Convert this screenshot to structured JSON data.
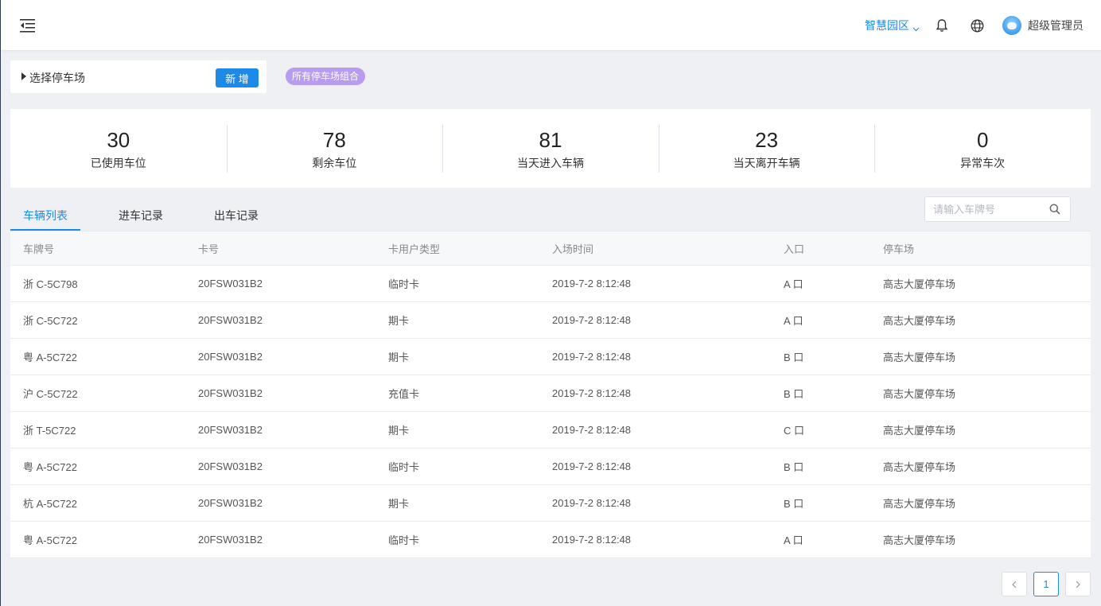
{
  "header": {
    "park_name": "智慧园区",
    "user_name": "超级管理员"
  },
  "selector": {
    "label": "选择停车场",
    "add_label": "新 增",
    "group_tag": "所有停车场组合"
  },
  "stats": [
    {
      "value": "30",
      "label": "已使用车位"
    },
    {
      "value": "78",
      "label": "剩余车位"
    },
    {
      "value": "81",
      "label": "当天进入车辆"
    },
    {
      "value": "23",
      "label": "当天离开车辆"
    },
    {
      "value": "0",
      "label": "异常车次"
    }
  ],
  "tabs": [
    {
      "label": "车辆列表",
      "active": true
    },
    {
      "label": "进车记录",
      "active": false
    },
    {
      "label": "出车记录",
      "active": false
    }
  ],
  "search": {
    "placeholder": "请输入车牌号"
  },
  "table": {
    "columns": [
      "车牌号",
      "卡号",
      "卡用户类型",
      "入场时间",
      "入口",
      "停车场"
    ],
    "rows": [
      [
        "浙 C-5C798",
        "20FSW031B2",
        "临时卡",
        "2019-7-2 8:12:48",
        "A 口",
        "高志大厦停车场"
      ],
      [
        "浙 C-5C722",
        "20FSW031B2",
        "期卡",
        "2019-7-2 8:12:48",
        "A 口",
        "高志大厦停车场"
      ],
      [
        "粤 A-5C722",
        "20FSW031B2",
        "期卡",
        "2019-7-2 8:12:48",
        "B 口",
        "高志大厦停车场"
      ],
      [
        "沪 C-5C722",
        "20FSW031B2",
        "充值卡",
        "2019-7-2 8:12:48",
        "B 口",
        "高志大厦停车场"
      ],
      [
        "浙 T-5C722",
        "20FSW031B2",
        "期卡",
        "2019-7-2 8:12:48",
        "C 口",
        "高志大厦停车场"
      ],
      [
        "粤 A-5C722",
        "20FSW031B2",
        "临时卡",
        "2019-7-2 8:12:48",
        "B 口",
        "高志大厦停车场"
      ],
      [
        "杭 A-5C722",
        "20FSW031B2",
        "期卡",
        "2019-7-2 8:12:48",
        "B 口",
        "高志大厦停车场"
      ],
      [
        "粤 A-5C722",
        "20FSW031B2",
        "临时卡",
        "2019-7-2 8:12:48",
        "A 口",
        "高志大厦停车场"
      ]
    ]
  },
  "pagination": {
    "current": "1"
  },
  "colors": {
    "accent": "#1e8ae8",
    "tag": "#b79cf0"
  }
}
